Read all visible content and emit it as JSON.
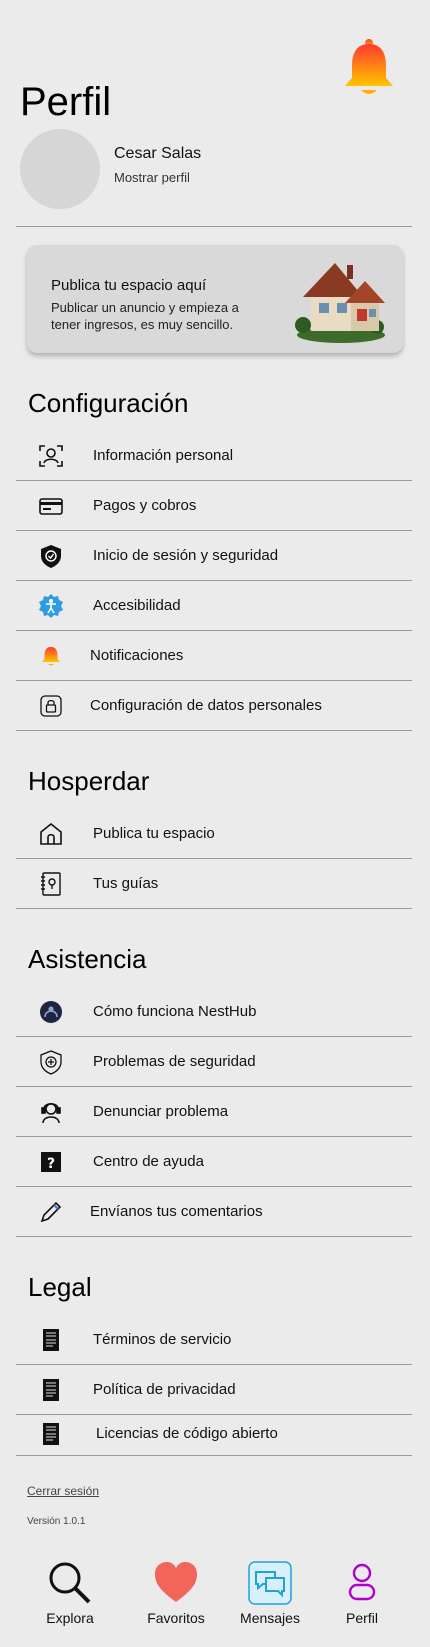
{
  "header": {
    "title": "Perfil",
    "bell_icon": "bell-icon"
  },
  "user": {
    "name": "Cesar Salas",
    "show_profile": "Mostrar perfil"
  },
  "promo": {
    "title": "Publica tu espacio aquí",
    "description": "Publicar un anuncio y empieza a tener ingresos, es muy sencillo.",
    "image": "house-illustration"
  },
  "sections": {
    "config": {
      "title": "Configuración",
      "items": [
        {
          "label": "Información personal",
          "icon": "user-id-icon"
        },
        {
          "label": "Pagos y cobros",
          "icon": "credit-card-icon"
        },
        {
          "label": "Inicio de sesión y seguridad",
          "icon": "shield-check-icon"
        },
        {
          "label": "Accesibilidad",
          "icon": "accessibility-icon"
        },
        {
          "label": "Notificaciones",
          "icon": "bell-icon"
        },
        {
          "label": "Configuración de datos personales",
          "icon": "lock-icon"
        }
      ]
    },
    "host": {
      "title": "Hosperdar",
      "items": [
        {
          "label": "Publica tu espacio",
          "icon": "home-icon"
        },
        {
          "label": "Tus guías",
          "icon": "guide-book-icon"
        }
      ]
    },
    "support": {
      "title": "Asistencia",
      "items": [
        {
          "label": "Cómo funciona NestHub",
          "icon": "nesthub-icon"
        },
        {
          "label": "Problemas de seguridad",
          "icon": "security-shield-icon"
        },
        {
          "label": "Denunciar problema",
          "icon": "support-agent-icon"
        },
        {
          "label": "Centro de ayuda",
          "icon": "help-icon"
        },
        {
          "label": "Envíanos tus comentarios",
          "icon": "pencil-icon"
        }
      ]
    },
    "legal": {
      "title": "Legal",
      "items": [
        {
          "label": "Términos de servicio",
          "icon": "document-icon"
        },
        {
          "label": "Política de privacidad",
          "icon": "document-icon"
        },
        {
          "label": "Licencias de código abierto",
          "icon": "document-icon"
        }
      ]
    }
  },
  "footer": {
    "logout": "Cerrar sesión",
    "version": "Versión 1.0.1"
  },
  "nav": [
    {
      "label": "Explora",
      "icon": "search-icon"
    },
    {
      "label": "Favoritos",
      "icon": "heart-icon"
    },
    {
      "label": "Mensajes",
      "icon": "chat-icon"
    },
    {
      "label": "Perfil",
      "icon": "user-icon"
    }
  ],
  "colors": {
    "background": "#ebebeb",
    "bell_gradient_top": "#ff3b2f",
    "bell_gradient_bottom": "#ffc400",
    "heart": "#f2655a",
    "profile_nav": "#b000d0",
    "message_nav": "#1fa3d8"
  }
}
